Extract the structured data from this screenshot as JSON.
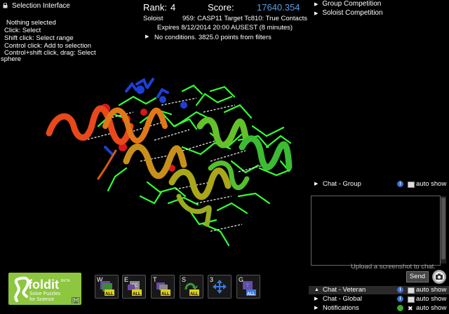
{
  "selection_panel": {
    "title": "Selection Interface",
    "lines": [
      "Nothing selected",
      "Click: Select",
      "Shift click: Select range",
      "Control click: Add to selection",
      "Control+shift click, drag: Select",
      "sphere"
    ]
  },
  "score_panel": {
    "rank_label": "Rank:",
    "rank_value": "4",
    "score_label": "Score:",
    "score_value": "17640.354",
    "mode": "Soloist",
    "puzzle": "959: CASP11 Target Tc810: True Contacts",
    "expires": "Expires 8/12/2014 20:00 AUSEST (8 minutes)",
    "conditions": "No conditions. 3825.0 points from filters"
  },
  "competition": {
    "group": "Group Competition",
    "soloist": "Soloist Competition"
  },
  "chat": {
    "group_label": "Chat - Group",
    "veteran_label": "Chat - Veteran",
    "global_label": "Chat - Global",
    "notifications_label": "Notifications",
    "auto_show": "auto show",
    "upload_hint": "Upload a screenshot to chat.",
    "send_label": "Send"
  },
  "logo": {
    "name": "foldit",
    "beta": "BETA",
    "tagline1": "Solve Puzzles",
    "tagline2": "for Science",
    "hotkey": "[H]"
  },
  "toolbar": [
    {
      "key": "W",
      "icon": "wiggle-all-icon"
    },
    {
      "key": "E",
      "icon": "sidechain-shake-icon"
    },
    {
      "key": "T",
      "icon": "tweak-icon"
    },
    {
      "key": "S",
      "icon": "shake-all-icon"
    },
    {
      "key": "3",
      "icon": "move-arrows-icon"
    },
    {
      "key": "G",
      "icon": "global-move-icon"
    }
  ],
  "colors": {
    "score_value": "#5aa0e6",
    "logo_green": "#8dc63f",
    "helix_start": "#e8401a",
    "helix_mid": "#c2a019",
    "helix_end": "#3dbb33",
    "sidechain": "#33ff33",
    "hbond_blue": "#1e3fd6"
  }
}
